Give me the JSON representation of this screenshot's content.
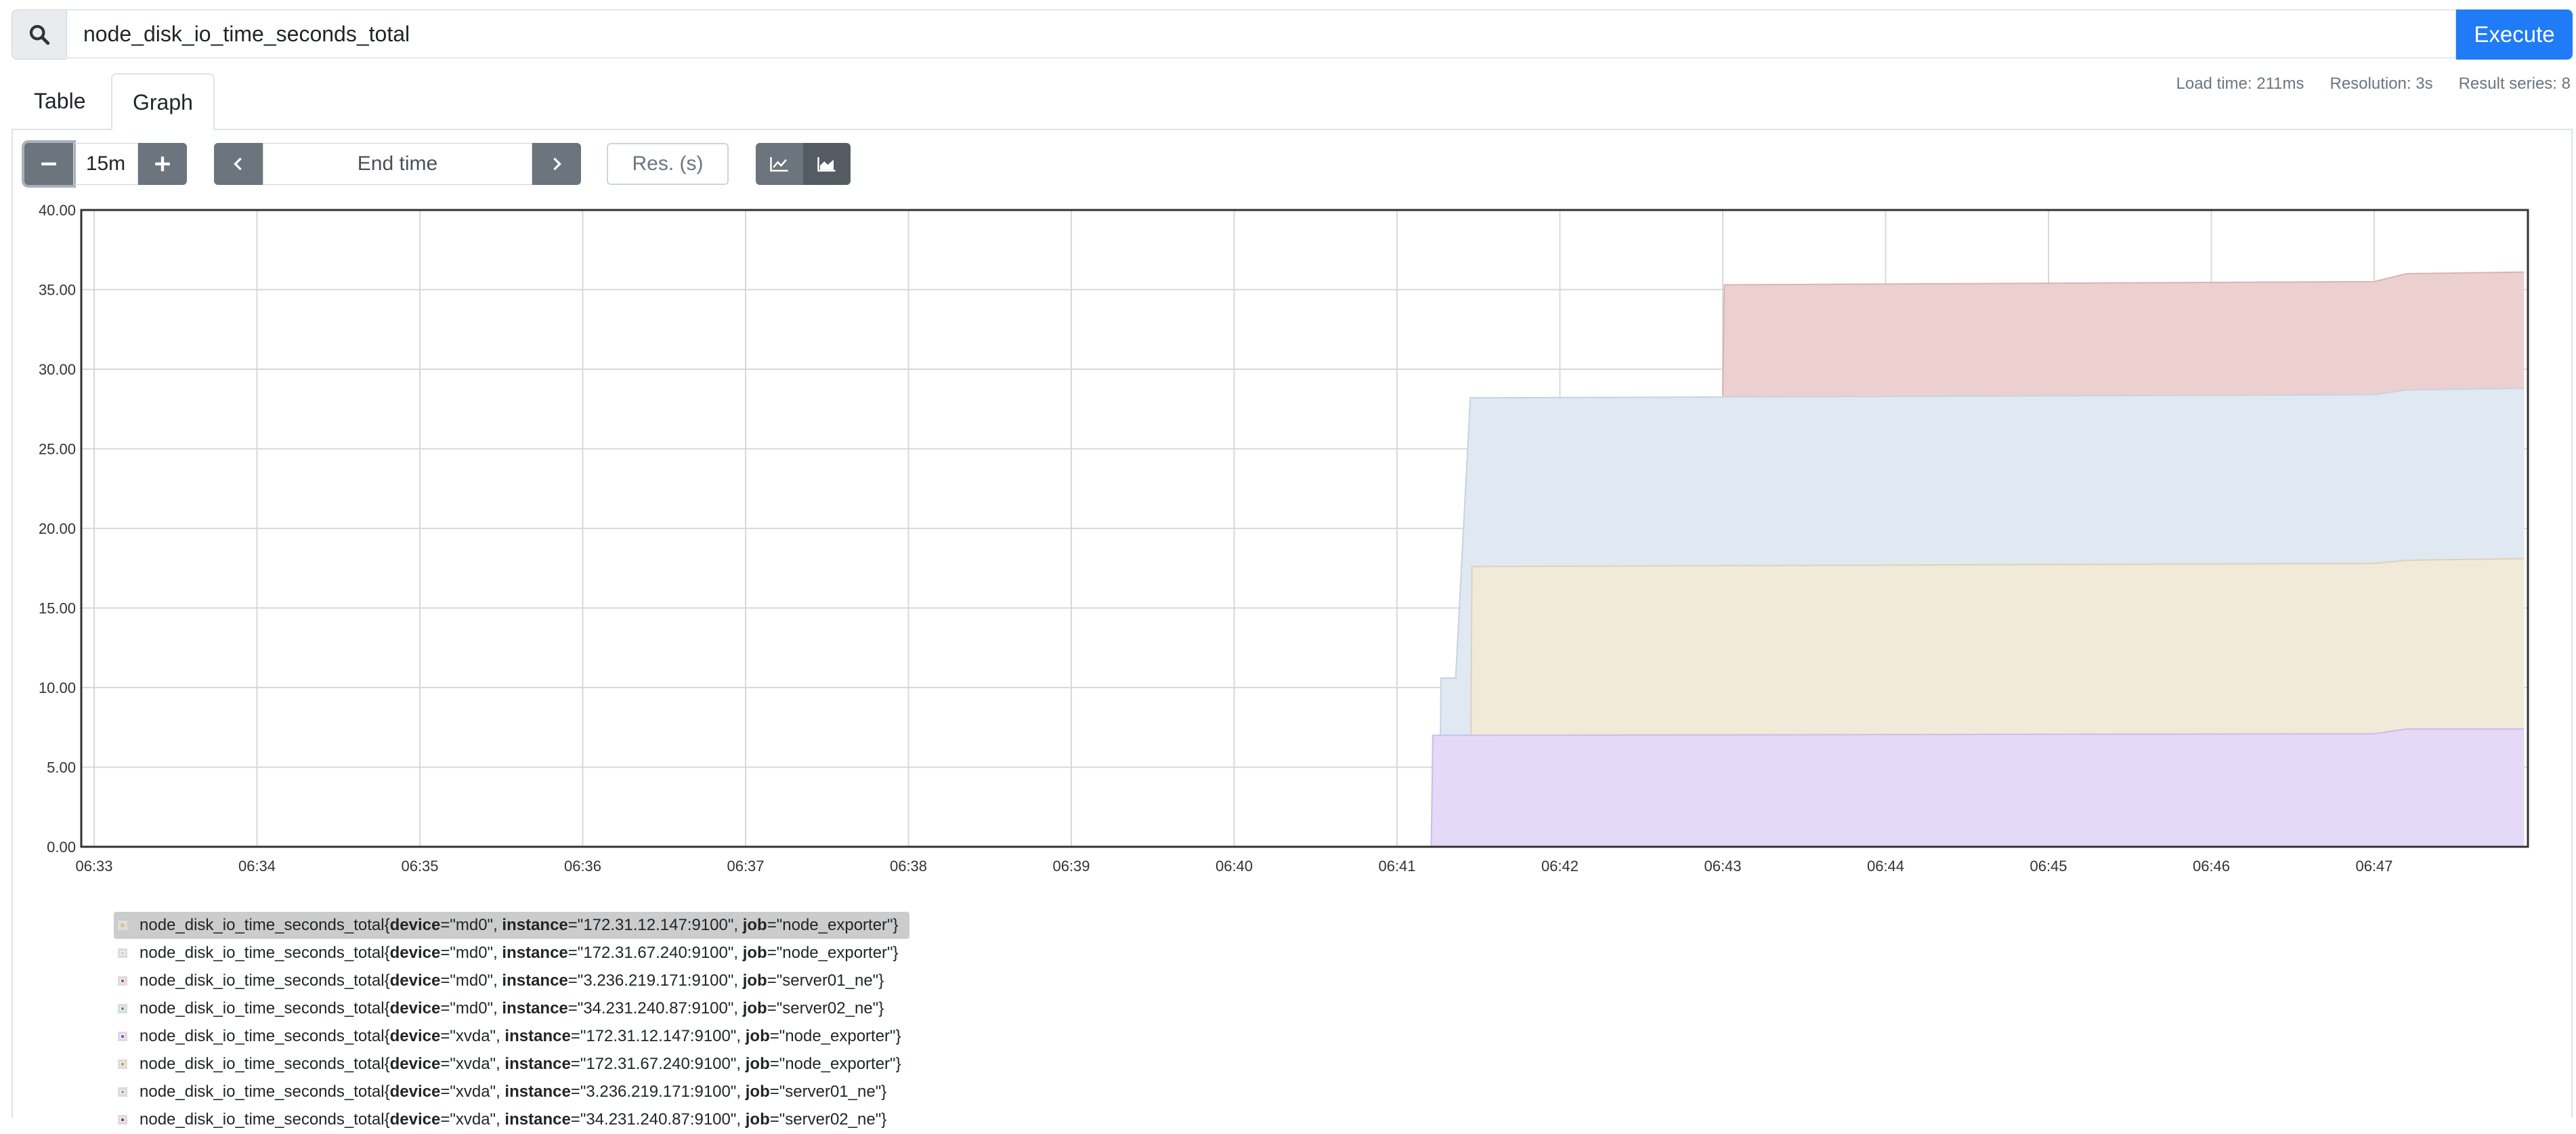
{
  "query": {
    "value": "node_disk_io_time_seconds_total",
    "execute_label": "Execute"
  },
  "tabs": [
    {
      "label": "Table"
    },
    {
      "label": "Graph"
    }
  ],
  "stats": {
    "load_time": "Load time: 211ms",
    "resolution": "Resolution: 3s",
    "result_series": "Result series: 8"
  },
  "controls": {
    "range_value": "15m",
    "end_time_placeholder": "End time",
    "resolution_placeholder": "Res. (s)"
  },
  "icons": {
    "search": "search-icon",
    "minus": "minus-icon",
    "plus": "plus-icon",
    "prev": "chevron-left-icon",
    "next": "chevron-right-icon",
    "line_chart": "line-chart-icon",
    "stacked_chart": "area-chart-icon"
  },
  "chart_data": {
    "type": "area",
    "stacked": true,
    "y_ticks": [
      "0.00",
      "5.00",
      "10.00",
      "15.00",
      "20.00",
      "25.00",
      "30.00",
      "35.00",
      "40.00"
    ],
    "x_ticks": [
      "06:33",
      "06:34",
      "06:35",
      "06:36",
      "06:37",
      "06:38",
      "06:39",
      "06:40",
      "06:41",
      "06:42",
      "06:43",
      "06:44",
      "06:45",
      "06:46",
      "06:47"
    ],
    "ylim": [
      0,
      40
    ],
    "x_minutes_range": [
      0,
      15
    ],
    "series": [
      {
        "color": "#ecd0d0",
        "line": "#d9b3b3",
        "points": [
          [
            10.0,
            28.3
          ],
          [
            10.01,
            35.3
          ],
          [
            14.0,
            35.5
          ],
          [
            14.2,
            36.0
          ],
          [
            14.92,
            36.1
          ]
        ]
      },
      {
        "color": "#e0e8f2",
        "line": "#c6d3e2",
        "points": [
          [
            8.26,
            0
          ],
          [
            8.27,
            10.6
          ],
          [
            8.3,
            10.6
          ],
          [
            8.36,
            10.6
          ],
          [
            8.45,
            28.2
          ],
          [
            14.0,
            28.4
          ],
          [
            14.2,
            28.7
          ],
          [
            14.92,
            28.8
          ]
        ]
      },
      {
        "color": "#f2ead8",
        "line": "#ddd2b8",
        "points": [
          [
            8.45,
            0
          ],
          [
            8.46,
            17.6
          ],
          [
            14.0,
            17.8
          ],
          [
            14.2,
            18.0
          ],
          [
            14.92,
            18.1
          ]
        ]
      },
      {
        "color": "#e4d9f7",
        "line": "#cbbcec",
        "points": [
          [
            8.21,
            0
          ],
          [
            8.22,
            7.0
          ],
          [
            14.0,
            7.1
          ],
          [
            14.2,
            7.4
          ],
          [
            14.92,
            7.4
          ]
        ]
      }
    ]
  },
  "legend": [
    {
      "prefix": "node_disk_io_time_seconds_total{",
      "device": "md0",
      "instance": "172.31.12.147:9100",
      "job": "node_exporter",
      "color": "#edc240"
    },
    {
      "prefix": "node_disk_io_time_seconds_total{",
      "device": "md0",
      "instance": "172.31.67.240:9100",
      "job": "node_exporter",
      "color": "#afd8f8"
    },
    {
      "prefix": "node_disk_io_time_seconds_total{",
      "device": "md0",
      "instance": "3.236.219.171:9100",
      "job": "server01_ne",
      "color": "#cb4b4b"
    },
    {
      "prefix": "node_disk_io_time_seconds_total{",
      "device": "md0",
      "instance": "34.231.240.87:9100",
      "job": "server02_ne",
      "color": "#4da74d"
    },
    {
      "prefix": "node_disk_io_time_seconds_total{",
      "device": "xvda",
      "instance": "172.31.12.147:9100",
      "job": "node_exporter",
      "color": "#9440ed"
    },
    {
      "prefix": "node_disk_io_time_seconds_total{",
      "device": "xvda",
      "instance": "172.31.67.240:9100",
      "job": "node_exporter",
      "color": "#bd9b33"
    },
    {
      "prefix": "node_disk_io_time_seconds_total{",
      "device": "xvda",
      "instance": "3.236.219.171:9100",
      "job": "server01_ne",
      "color": "#8cacc6"
    },
    {
      "prefix": "node_disk_io_time_seconds_total{",
      "device": "xvda",
      "instance": "34.231.240.87:9100",
      "job": "server02_ne",
      "color": "#a23c3c"
    }
  ],
  "legend_keys": {
    "device": "device",
    "instance": "instance",
    "job": "job"
  }
}
